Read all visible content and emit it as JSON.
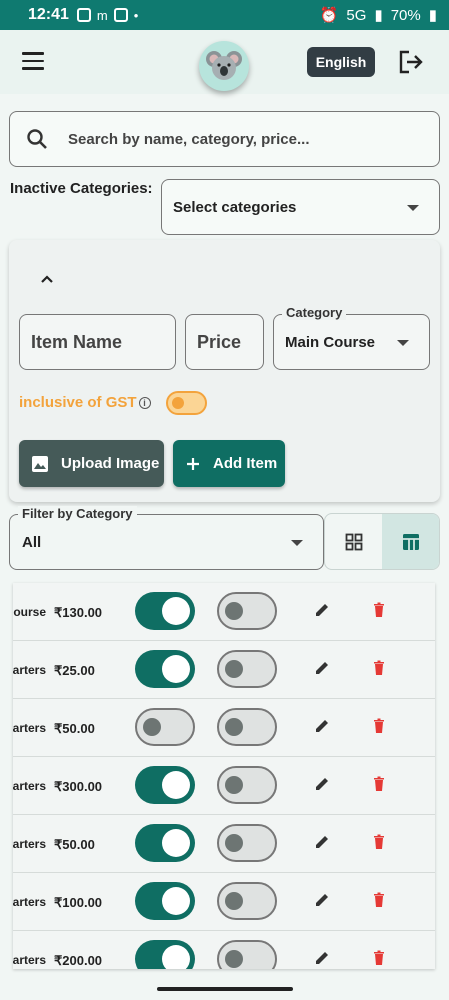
{
  "status_bar": {
    "time": "12:41",
    "battery": "70%",
    "network": "5G"
  },
  "header": {
    "language_label": "English"
  },
  "search": {
    "placeholder": "Search by name, category, price..."
  },
  "inactive": {
    "label": "Inactive Categories:",
    "select_placeholder": "Select categories"
  },
  "form": {
    "item_name_placeholder": "Item Name",
    "price_placeholder": "Price",
    "category_label": "Category",
    "category_value": "Main Course",
    "gst_label": "inclusive of GST",
    "upload_label": "Upload Image",
    "add_label": "Add Item"
  },
  "filter": {
    "label": "Filter by Category",
    "value": "All"
  },
  "rows": [
    {
      "category": "Main Course",
      "price": "₹130.00",
      "toggle1": true,
      "toggle2": false
    },
    {
      "category": "Starters",
      "price": "₹25.00",
      "toggle1": true,
      "toggle2": false
    },
    {
      "category": "Starters",
      "price": "₹50.00",
      "toggle1": false,
      "toggle2": false
    },
    {
      "category": "Starters",
      "price": "₹300.00",
      "toggle1": true,
      "toggle2": false
    },
    {
      "category": "Starters",
      "price": "₹50.00",
      "toggle1": true,
      "toggle2": false
    },
    {
      "category": "Starters",
      "price": "₹100.00",
      "toggle1": true,
      "toggle2": false
    },
    {
      "category": "Starters",
      "price": "₹200.00",
      "toggle1": true,
      "toggle2": false
    }
  ],
  "colors": {
    "primary": "#0f6e63",
    "accent": "#f3a33c",
    "danger": "#e53935",
    "status_bar": "#0f7a70"
  }
}
